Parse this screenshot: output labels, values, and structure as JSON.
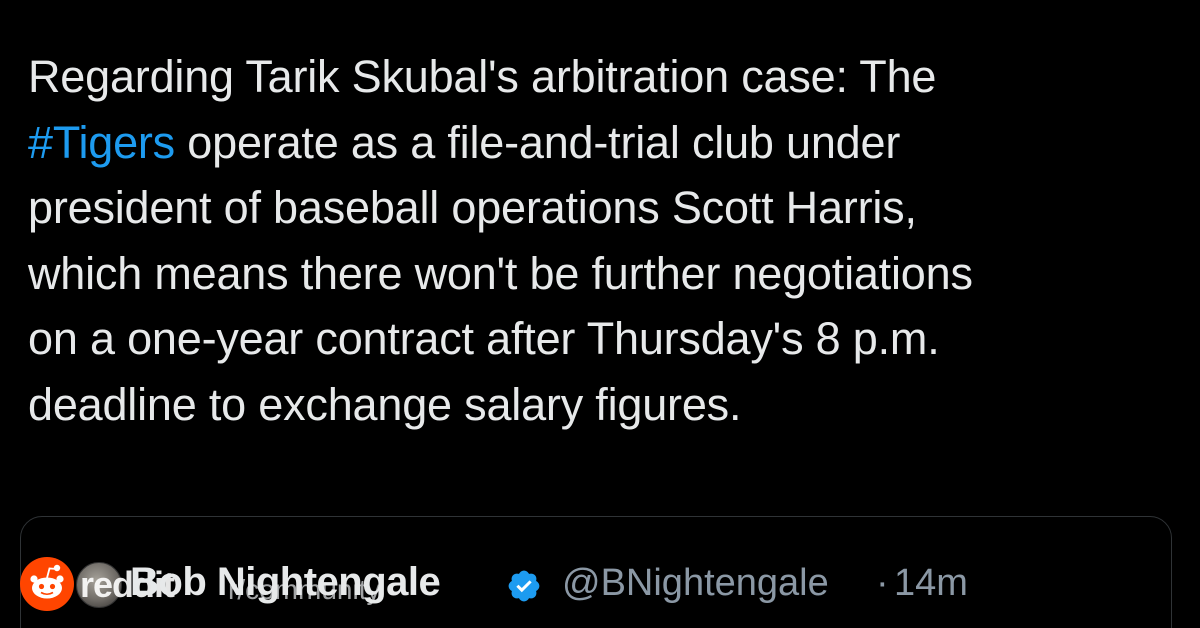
{
  "tweet": {
    "lines": [
      "Regarding Tarik Skubal's arbitration case: The",
      "operate as a file-and-trial club under",
      "president of baseball operations Scott Harris,",
      "which means there won't be further negotiations",
      "on a one-year contract after Thursday's 8 p.m.",
      "deadline to exchange salary figures."
    ],
    "hashtag": "#Tigers",
    "hashtag_color": "#1d9bf0",
    "text_color": "#e7e9ea"
  },
  "quote": {
    "author_name": "Bob Nightengale",
    "handle": "@BNightengale",
    "separator": "·",
    "time_ago": "14m",
    "verified_icon": "verified-badge-icon",
    "verified_color": "#1d9bf0"
  },
  "reddit_overlay": {
    "wordmark": "reddit",
    "community_label": "r/community",
    "logo_icon": "reddit-snoo-icon",
    "logo_color": "#ff4500"
  },
  "colors": {
    "background": "#000000",
    "secondary_text": "#8b98a5",
    "card_border": "#2f3336"
  }
}
